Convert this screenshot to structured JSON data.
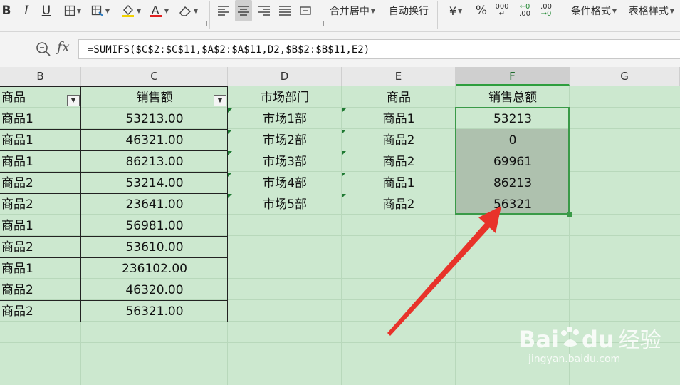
{
  "toolbar": {
    "bold": "B",
    "italic": "I",
    "underline": "U",
    "merge_center": "合并居中",
    "wrap_text": "自动换行",
    "currency_symbol": "¥",
    "percent": "%",
    "thousands": "000",
    "inc_decimal": ".00",
    "dec_decimal": ".00",
    "conditional_format": "条件格式",
    "table_style": "表格样式"
  },
  "formula_bar": {
    "fx_label": "fx",
    "formula": "=SUMIFS($C$2:$C$11,$A$2:$A$11,D2,$B$2:$B$11,E2)"
  },
  "columns": [
    "B",
    "C",
    "D",
    "E",
    "F",
    "G"
  ],
  "selected_column": "F",
  "table_left": {
    "headers": [
      "商品",
      "销售额"
    ],
    "rows": [
      [
        "商品1",
        "53213.00"
      ],
      [
        "商品1",
        "46321.00"
      ],
      [
        "商品1",
        "86213.00"
      ],
      [
        "商品2",
        "53214.00"
      ],
      [
        "商品2",
        "23641.00"
      ],
      [
        "商品1",
        "56981.00"
      ],
      [
        "商品2",
        "53610.00"
      ],
      [
        "商品1",
        "236102.00"
      ],
      [
        "商品2",
        "46320.00"
      ],
      [
        "商品2",
        "56321.00"
      ]
    ]
  },
  "table_right": {
    "headers": [
      "市场部门",
      "商品",
      "销售总额"
    ],
    "rows": [
      [
        "市场1部",
        "商品1",
        "53213"
      ],
      [
        "市场2部",
        "商品2",
        "0"
      ],
      [
        "市场3部",
        "商品2",
        "69961"
      ],
      [
        "市场4部",
        "商品1",
        "86213"
      ],
      [
        "市场5部",
        "商品2",
        "56321"
      ]
    ]
  },
  "watermark": {
    "brand": "Bai",
    "brand_du": "du",
    "brand_cn": "经验",
    "url": "jingyan.baidu.com"
  },
  "colors": {
    "sheet_bg": "#cce8cf",
    "selection": "#3a9a48",
    "arrow": "#e8322a"
  }
}
